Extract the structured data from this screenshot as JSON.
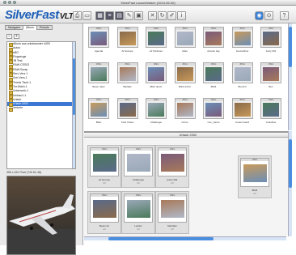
{
  "window": {
    "title": "SilverFast LaunchWatch (1024-05-30)"
  },
  "toolbar": {
    "logo_main": "SilverFast",
    "logo_sub": "VLT",
    "buttons": [
      "print-icon",
      "tray-icon",
      "grid-view-icon",
      "list-view-icon",
      "filmstrip-icon",
      "wrench-icon",
      "image-icon",
      "close-icon",
      "rotate-icon",
      "edit-icon",
      "info-icon",
      "search-icon",
      "settings-icon",
      "help-icon"
    ]
  },
  "left": {
    "tabs": [
      "Navigator",
      "Album",
      "Presets"
    ],
    "active_tab": 1,
    "btn_minus": "–",
    "btn_plus": "+",
    "tree": [
      "Album aus unbekannter 4400",
      "Autos",
      "eBO",
      "Flugzeuge",
      "JB Test",
      "RAW-CSS02",
      "RAW-Scrap",
      "Serv-Vers 1",
      "Sort-Vers-1",
      "Tennis Tisch-1",
      "Tor-Mach-1",
      "Unterwerk-1",
      "Umbau1-1",
      "Urlaub",
      "Urlaub 2002",
      "Verkehr"
    ],
    "selected_index": 14,
    "preview_info": "355 x 451 Pixel (749 Kh 48)"
  },
  "grid": {
    "cells": [
      {
        "cap": "Agenda",
        "sub": ""
      },
      {
        "cap": "Air Europe",
        "sub": ""
      },
      {
        "cap": "Air Panhuen",
        "sub": ""
      },
      {
        "cap": "Atlas",
        "sub": ""
      },
      {
        "cap": "Avocan bay",
        "sub": ""
      },
      {
        "cap": "Avocanthus",
        "sub": ""
      },
      {
        "cap": "Jetcy 001",
        "sub": ""
      },
      {
        "cap": "Beam Jaan",
        "sub": ""
      },
      {
        "cap": "Barltals",
        "sub": ""
      },
      {
        "cap": "Blick durch",
        "sub": ""
      },
      {
        "cap": "Blick durch",
        "sub": ""
      },
      {
        "cap": "Bild4",
        "sub": ""
      },
      {
        "cap": "Bunsch",
        "sub": ""
      },
      {
        "cap": "Bus",
        "sub": ""
      },
      {
        "cap": "Blaci",
        "sub": ""
      },
      {
        "cap": "Cold Unites",
        "sub": ""
      },
      {
        "cap": "Challenger",
        "sub": ""
      },
      {
        "cap": "Cirrus",
        "sub": ""
      },
      {
        "cap": "Coc_Jamie",
        "sub": ""
      },
      {
        "cap": "Coast Guard",
        "sub": ""
      },
      {
        "cap": "Coastline",
        "sub": ""
      }
    ]
  },
  "lightbox": {
    "title": "Urlaub 2002",
    "cells": [
      {
        "cap": "Air Europe",
        "sub": "1/2"
      },
      {
        "cap": "Challenger",
        "sub": "1/2"
      },
      {
        "cap": "jetcor 001",
        "sub": "1/2"
      },
      {
        "cap": "Bild4",
        "sub": "1/2"
      },
      {
        "cap": "Beam Air",
        "sub": "1/2"
      },
      {
        "cap": "Landor",
        "sub": "1/2"
      },
      {
        "cap": "Meridian",
        "sub": "1/2"
      }
    ]
  },
  "colors": {
    "accent": "#3a78d4",
    "logo": "#1e5fb8",
    "folder": "#d8b24a"
  }
}
